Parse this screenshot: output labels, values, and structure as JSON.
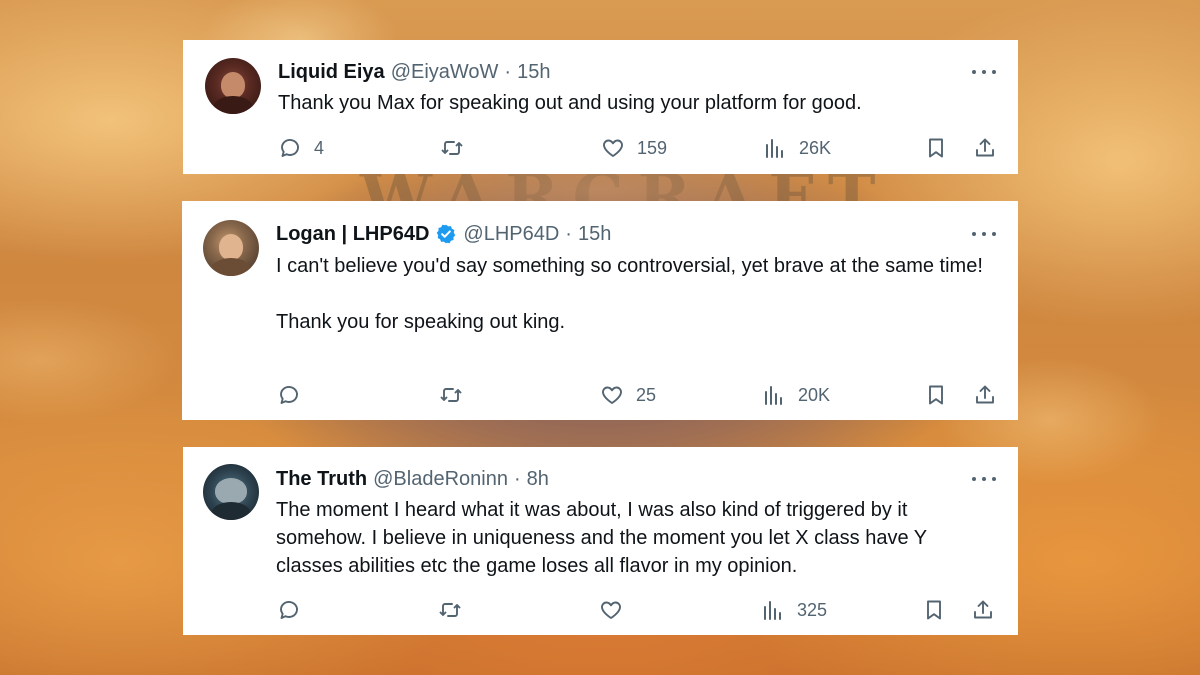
{
  "background": {
    "wordmark": "WARCRAFT"
  },
  "tweets": [
    {
      "name": "Liquid Eiya",
      "handle": "@EiyaWoW",
      "separator": "·",
      "time": "15h",
      "verified": false,
      "paragraphs": [
        "Thank you Max for speaking out and using your platform for good."
      ],
      "replies": "4",
      "retweets": "",
      "likes": "159",
      "views": "26K"
    },
    {
      "name": "Logan | LHP64D",
      "handle": "@LHP64D",
      "separator": "·",
      "time": "15h",
      "verified": true,
      "paragraphs": [
        "I can't believe you'd say something so controversial, yet brave at the same time!",
        "Thank you for speaking out king."
      ],
      "replies": "",
      "retweets": "",
      "likes": "25",
      "views": "20K"
    },
    {
      "name": "The Truth",
      "handle": "@BladeRoninn",
      "separator": "·",
      "time": "8h",
      "verified": false,
      "paragraphs": [
        "The moment I heard what it was about, I was also kind of triggered by it somehow. I believe in uniqueness and the moment you let X class have Y classes abilities etc the game loses all flavor in my opinion."
      ],
      "replies": "",
      "retweets": "",
      "likes": "",
      "views": "325"
    }
  ],
  "icons": {
    "reply": "speech-bubble-icon",
    "retweet": "retweet-icon",
    "like": "heart-icon",
    "views": "bar-chart-icon",
    "bookmark": "bookmark-icon",
    "share": "share-icon",
    "more": "more-dots-icon",
    "verified": "verified-badge-icon"
  },
  "colors": {
    "verified_blue": "#1d9bf0",
    "secondary_text": "#536471",
    "primary_text": "#0f1419"
  }
}
